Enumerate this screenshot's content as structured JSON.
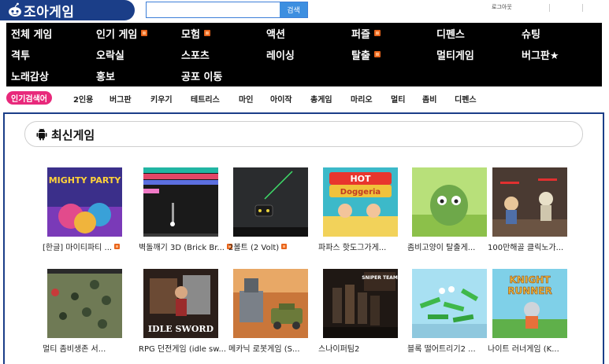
{
  "header": {
    "logo_text": "조아게임",
    "search_placeholder": "",
    "search_button": "검색",
    "login": "로그아웃"
  },
  "categories": [
    {
      "label": "전체 게임",
      "new": false
    },
    {
      "label": "인기 게임",
      "new": true
    },
    {
      "label": "모험",
      "new": true
    },
    {
      "label": "액션",
      "new": false
    },
    {
      "label": "퍼즐",
      "new": true
    },
    {
      "label": "디펜스",
      "new": false
    },
    {
      "label": "슈팅",
      "new": false
    },
    {
      "label": "격투",
      "new": false
    },
    {
      "label": "오락실",
      "new": false
    },
    {
      "label": "스포츠",
      "new": false
    },
    {
      "label": "레이싱",
      "new": false
    },
    {
      "label": "탈출",
      "new": true
    },
    {
      "label": "멀티게임",
      "new": false
    },
    {
      "label": "버그판★",
      "new": false
    },
    {
      "label": "노래감상",
      "new": false
    },
    {
      "label": "홍보",
      "new": false
    },
    {
      "label": "공포 이동",
      "new": false
    }
  ],
  "popular": {
    "label": "인기검색어",
    "tags": [
      "2인용",
      "버그판",
      "키우기",
      "테트리스",
      "마인",
      "아이작",
      "총게임",
      "마리오",
      "멀티",
      "좀비",
      "디펜스"
    ]
  },
  "section": {
    "title": "최신게임"
  },
  "games": [
    {
      "title": "[한글] 마이티파티 ...",
      "new": true
    },
    {
      "title": "벽돌깨기 3D (Brick Br...",
      "new": true
    },
    {
      "title": "2볼트 (2 Volt)",
      "new": true
    },
    {
      "title": "파파스 핫도그가게...",
      "new": false
    },
    {
      "title": "좀비고양이 탈출게...",
      "new": false
    },
    {
      "title": "100만해골 클릭노가...",
      "new": false
    },
    {
      "title": "멀티 좀비생존 서...",
      "new": false
    },
    {
      "title": "RPG 던전게임 (idle sw...",
      "new": false
    },
    {
      "title": "메카닉 로봇게임 (S...",
      "new": false
    },
    {
      "title": "스나이퍼팀2",
      "new": false
    },
    {
      "title": "블록 떨어트리기2 ...",
      "new": false
    },
    {
      "title": "나이트 러너게임 (K...",
      "new": false
    }
  ],
  "thumb_text": {
    "mighty": "MIGHTY PARTY",
    "hot": "HOT",
    "doggeria": "Doggeria",
    "idle": "IDLE SWORD",
    "sniper": "SNIPER TEAM",
    "knight": "KNIGHT",
    "runner": "RUNNER"
  },
  "colors": {
    "brand": "#1b3e88",
    "search_button": "#3d8fe0",
    "popular_label": "#e8297b",
    "new_badge": "#e8641b"
  }
}
